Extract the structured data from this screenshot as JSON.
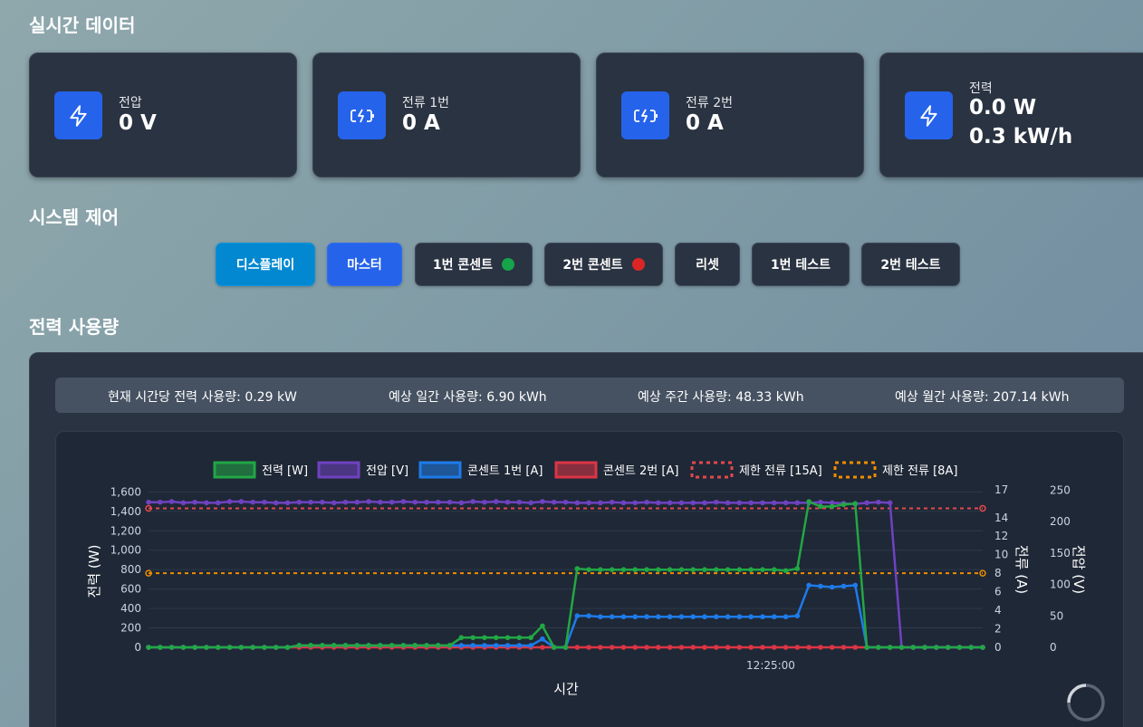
{
  "realtime": {
    "title": "실시간 데이터",
    "cards": [
      {
        "label": "전압",
        "value": "0 V",
        "icon": "lightning-icon"
      },
      {
        "label": "전류 1번",
        "value": "0 A",
        "icon": "battery-charging-icon"
      },
      {
        "label": "전류 2번",
        "value": "0 A",
        "icon": "battery-charging-icon"
      },
      {
        "label": "전력",
        "value": "0.0 W",
        "value2": "0.3 kW/h",
        "icon": "lightning-icon"
      }
    ]
  },
  "control": {
    "title": "시스템 제어",
    "buttons": [
      {
        "label": "디스플레이",
        "style": "cyan"
      },
      {
        "label": "마스터",
        "style": "blue"
      },
      {
        "label": "1번 콘센트",
        "status_color": "#16a34a"
      },
      {
        "label": "2번 콘센트",
        "status_color": "#dc2626"
      },
      {
        "label": "리셋"
      },
      {
        "label": "1번 테스트"
      },
      {
        "label": "2번 테스트"
      }
    ]
  },
  "usage": {
    "title": "전력 사용량",
    "stats": [
      "현재 시간당 전력 사용량: 0.29 kW",
      "예상 일간 사용량: 6.90 kWh",
      "예상 주간 사용량: 48.33 kWh",
      "예상 월간 사용량: 207.14 kWh"
    ]
  },
  "colors": {
    "power": "#22a745",
    "voltage": "#6f42c1",
    "outlet1": "#1e7bea",
    "outlet2": "#dc3545",
    "limit15": "#e5484d",
    "limit8": "#f08c00"
  },
  "chart_data": {
    "type": "line",
    "xlabel": "시간",
    "x_tick_labels": [
      "12:25:00"
    ],
    "y_left_label": "전력 (W)",
    "y_left_ticks": [
      "0",
      "200",
      "400",
      "600",
      "800",
      "1,000",
      "1,200",
      "1,400",
      "1,600"
    ],
    "y_left_range": [
      0,
      1650
    ],
    "y_current_label": "전류 (A)",
    "y_current_ticks": [
      "0",
      "2",
      "4",
      "6",
      "8",
      "10",
      "12",
      "14",
      "17"
    ],
    "y_current_range": [
      0,
      17.3
    ],
    "y_voltage_label": "전압 (V)",
    "y_voltage_ticks": [
      "0",
      "50",
      "100",
      "150",
      "200",
      "250"
    ],
    "y_voltage_range": [
      0,
      255
    ],
    "legend_position": "top",
    "series": [
      {
        "name": "전력 [W]",
        "axis": "power",
        "color": "#22a745",
        "values": [
          0,
          0,
          0,
          0,
          0,
          0,
          0,
          0,
          0,
          0,
          0,
          0,
          0,
          20,
          20,
          20,
          20,
          20,
          20,
          20,
          20,
          20,
          20,
          20,
          20,
          20,
          20,
          100,
          100,
          100,
          100,
          100,
          100,
          100,
          220,
          0,
          0,
          810,
          800,
          800,
          800,
          800,
          800,
          800,
          800,
          800,
          800,
          800,
          800,
          800,
          800,
          800,
          800,
          800,
          800,
          790,
          810,
          1500,
          1450,
          1450,
          1470,
          1480,
          0,
          0,
          0,
          0,
          0,
          0,
          0,
          0,
          0,
          0,
          0
        ]
      },
      {
        "name": "전압 [V]",
        "axis": "voltage",
        "color": "#6f42c1",
        "values": [
          231,
          231,
          232,
          230,
          231,
          230,
          230,
          232,
          232,
          231,
          231,
          230,
          230,
          231,
          231,
          231,
          230,
          231,
          231,
          232,
          231,
          231,
          232,
          231,
          231,
          231,
          231,
          230,
          232,
          231,
          232,
          231,
          231,
          230,
          232,
          231,
          231,
          230,
          230,
          230,
          231,
          230,
          230,
          231,
          230,
          230,
          230,
          230,
          230,
          231,
          230,
          230,
          230,
          230,
          230,
          230,
          230,
          230,
          231,
          230,
          229,
          228,
          230,
          231,
          230,
          0,
          0,
          0,
          0,
          0,
          0,
          0,
          0
        ]
      },
      {
        "name": "콘센트 1번 [A]",
        "axis": "current",
        "color": "#1e7bea",
        "values": [
          0,
          0,
          0,
          0,
          0,
          0,
          0,
          0,
          0,
          0,
          0,
          0,
          0,
          0.2,
          0.2,
          0.2,
          0.2,
          0.2,
          0.2,
          0.2,
          0.2,
          0.2,
          0.2,
          0.2,
          0.2,
          0.2,
          0.2,
          0.2,
          0.2,
          0.2,
          0.2,
          0.2,
          0.2,
          0.2,
          0.9,
          0,
          0,
          3.4,
          3.4,
          3.3,
          3.3,
          3.3,
          3.3,
          3.3,
          3.3,
          3.3,
          3.3,
          3.3,
          3.3,
          3.3,
          3.3,
          3.3,
          3.3,
          3.3,
          3.3,
          3.3,
          3.4,
          6.7,
          6.6,
          6.5,
          6.6,
          6.7,
          0,
          0,
          0,
          0,
          0,
          0,
          0,
          0,
          0,
          0,
          0
        ]
      },
      {
        "name": "콘센트 2번 [A]",
        "axis": "current",
        "color": "#dc3545",
        "values": [
          0,
          0,
          0,
          0,
          0,
          0,
          0,
          0,
          0,
          0,
          0,
          0,
          0,
          0,
          0,
          0,
          0,
          0,
          0,
          0,
          0,
          0,
          0,
          0,
          0,
          0,
          0,
          0,
          0,
          0,
          0,
          0,
          0,
          0,
          0,
          0,
          0,
          0,
          0,
          0,
          0,
          0,
          0,
          0,
          0,
          0,
          0,
          0,
          0,
          0,
          0,
          0,
          0,
          0,
          0,
          0,
          0,
          0,
          0,
          0,
          0,
          0,
          0,
          0,
          0,
          0,
          0,
          0,
          0,
          0,
          0,
          0,
          0
        ]
      },
      {
        "name": "제한 전류 [15A]",
        "axis": "current",
        "color": "#e5484d",
        "dashed": true,
        "constant": 15
      },
      {
        "name": "제한 전류 [8A]",
        "axis": "current",
        "color": "#f08c00",
        "dashed": true,
        "constant": 8
      }
    ]
  }
}
